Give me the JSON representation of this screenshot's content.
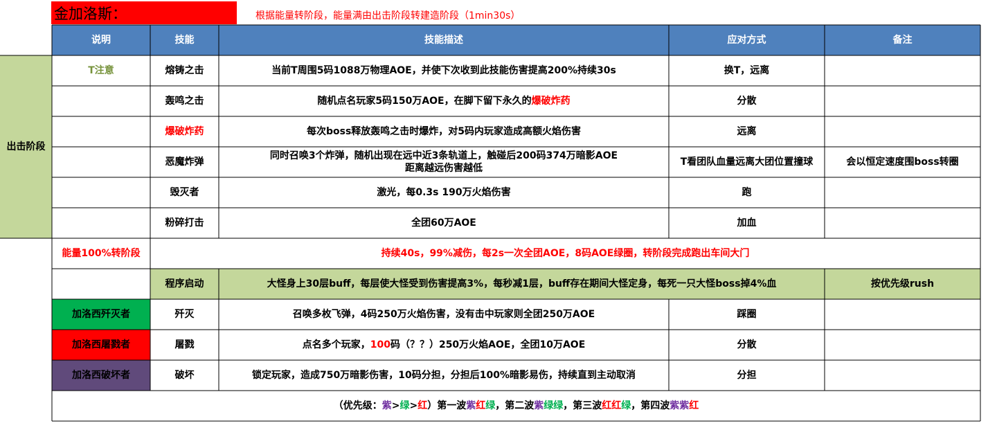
{
  "title": "金加洛斯：",
  "phase_note": "根据能量转阶段，能量满由出击阶段转建造阶段（1min30s）",
  "headers": [
    "说明",
    "技能",
    "技能描述",
    "应对方式",
    "备注"
  ],
  "phase1_label": "出击阶段",
  "rows": [
    {
      "note": "T注意",
      "skill": "熔铸之击",
      "desc": "当前T周围5码1088万物理AOE，并使下次收到此技能伤害提高200%持续30s",
      "response": "换T，远离",
      "remark": ""
    },
    {
      "note": "",
      "skill": "轰鸣之击",
      "desc_a": "随机点名玩家5码150万AOE，在脚下留下永久的",
      "desc_b": "爆破炸药",
      "response": "分散",
      "remark": ""
    },
    {
      "note": "",
      "skill": "爆破炸药",
      "desc": "每次boss释放轰鸣之击时爆炸，对5码内玩家造成高额火焰伤害",
      "response": "远离",
      "remark": ""
    },
    {
      "note": "",
      "skill": "恶魔炸弹",
      "desc_a": "同时召唤3个炸弹，随机出现在远中近3条轨道上，触碰后200码374万暗影AOE",
      "desc_b": "距离越远伤害越低",
      "response": "T看团队血量远离大团位置撞球",
      "remark": "会以恒定速度围boss转圈"
    },
    {
      "note": "",
      "skill": "毁灭者",
      "desc": "激光，每0.3s 190万火焰伤害",
      "response": "跑",
      "remark": ""
    },
    {
      "note": "",
      "skill": "粉碎打击",
      "desc": "全团60万AOE",
      "response": "加血",
      "remark": ""
    }
  ],
  "energy_row": {
    "label": "能量100%转阶段",
    "desc": "持续40s，99%减伤，每2s一次全团AOE，8码AOE绿圈，转阶段完成跑出车间大门"
  },
  "program_row": {
    "skill": "程序启动",
    "desc": "大怪身上30层buff，每层使大怪受到伤害提高3%，每秒减1层，buff存在期间大怪定身，每死一只大怪boss掉4%血",
    "response": "按优先级rush"
  },
  "add_rows": [
    {
      "name": "加洛西歼灭者",
      "skill": "歼灭",
      "desc": "召唤多枚飞弹，4码250万火焰伤害，没有击中玩家则全团250万AOE",
      "response": "踩圈",
      "bg": "#00b050"
    },
    {
      "name": "加洛西屠戮者",
      "skill": "屠戮",
      "desc_a": "点名多个玩家，",
      "desc_red": "100",
      "desc_b": "码（？？）250万火焰AOE，全团10万AOE",
      "response": "分散",
      "bg": "#ff0000"
    },
    {
      "name": "加洛西破坏者",
      "skill": "破坏",
      "desc": "锁定玩家，造成750万暗影伤害，10码分担，分担后100%暗影易伤，持续直到主动取消",
      "response": "分担",
      "bg": "#604a7b"
    }
  ],
  "priority": {
    "p1": "（优先级：",
    "purple1": "紫",
    "gt1": ">",
    "green1": "绿",
    "gt2": ">",
    "red1": "红",
    "p2": "）第一波",
    "w1a": "紫",
    "w1b": "红",
    "w1c": "绿",
    "p3": "，第二波",
    "w2a": "紫",
    "w2b": "绿",
    "w2c": "绿",
    "p4": "，第三波",
    "w3a": "红",
    "w3b": "红",
    "w3c": "绿",
    "p5": "，第四波",
    "w4a": "紫",
    "w4b": "紫",
    "w4c": "红"
  },
  "colors": {
    "header_bg": "#4f81bd",
    "phase_bg": "#c4d79b",
    "program_bg": "#c4d79b",
    "title_bg": "#ff0000",
    "accent_red": "#ff0000"
  }
}
